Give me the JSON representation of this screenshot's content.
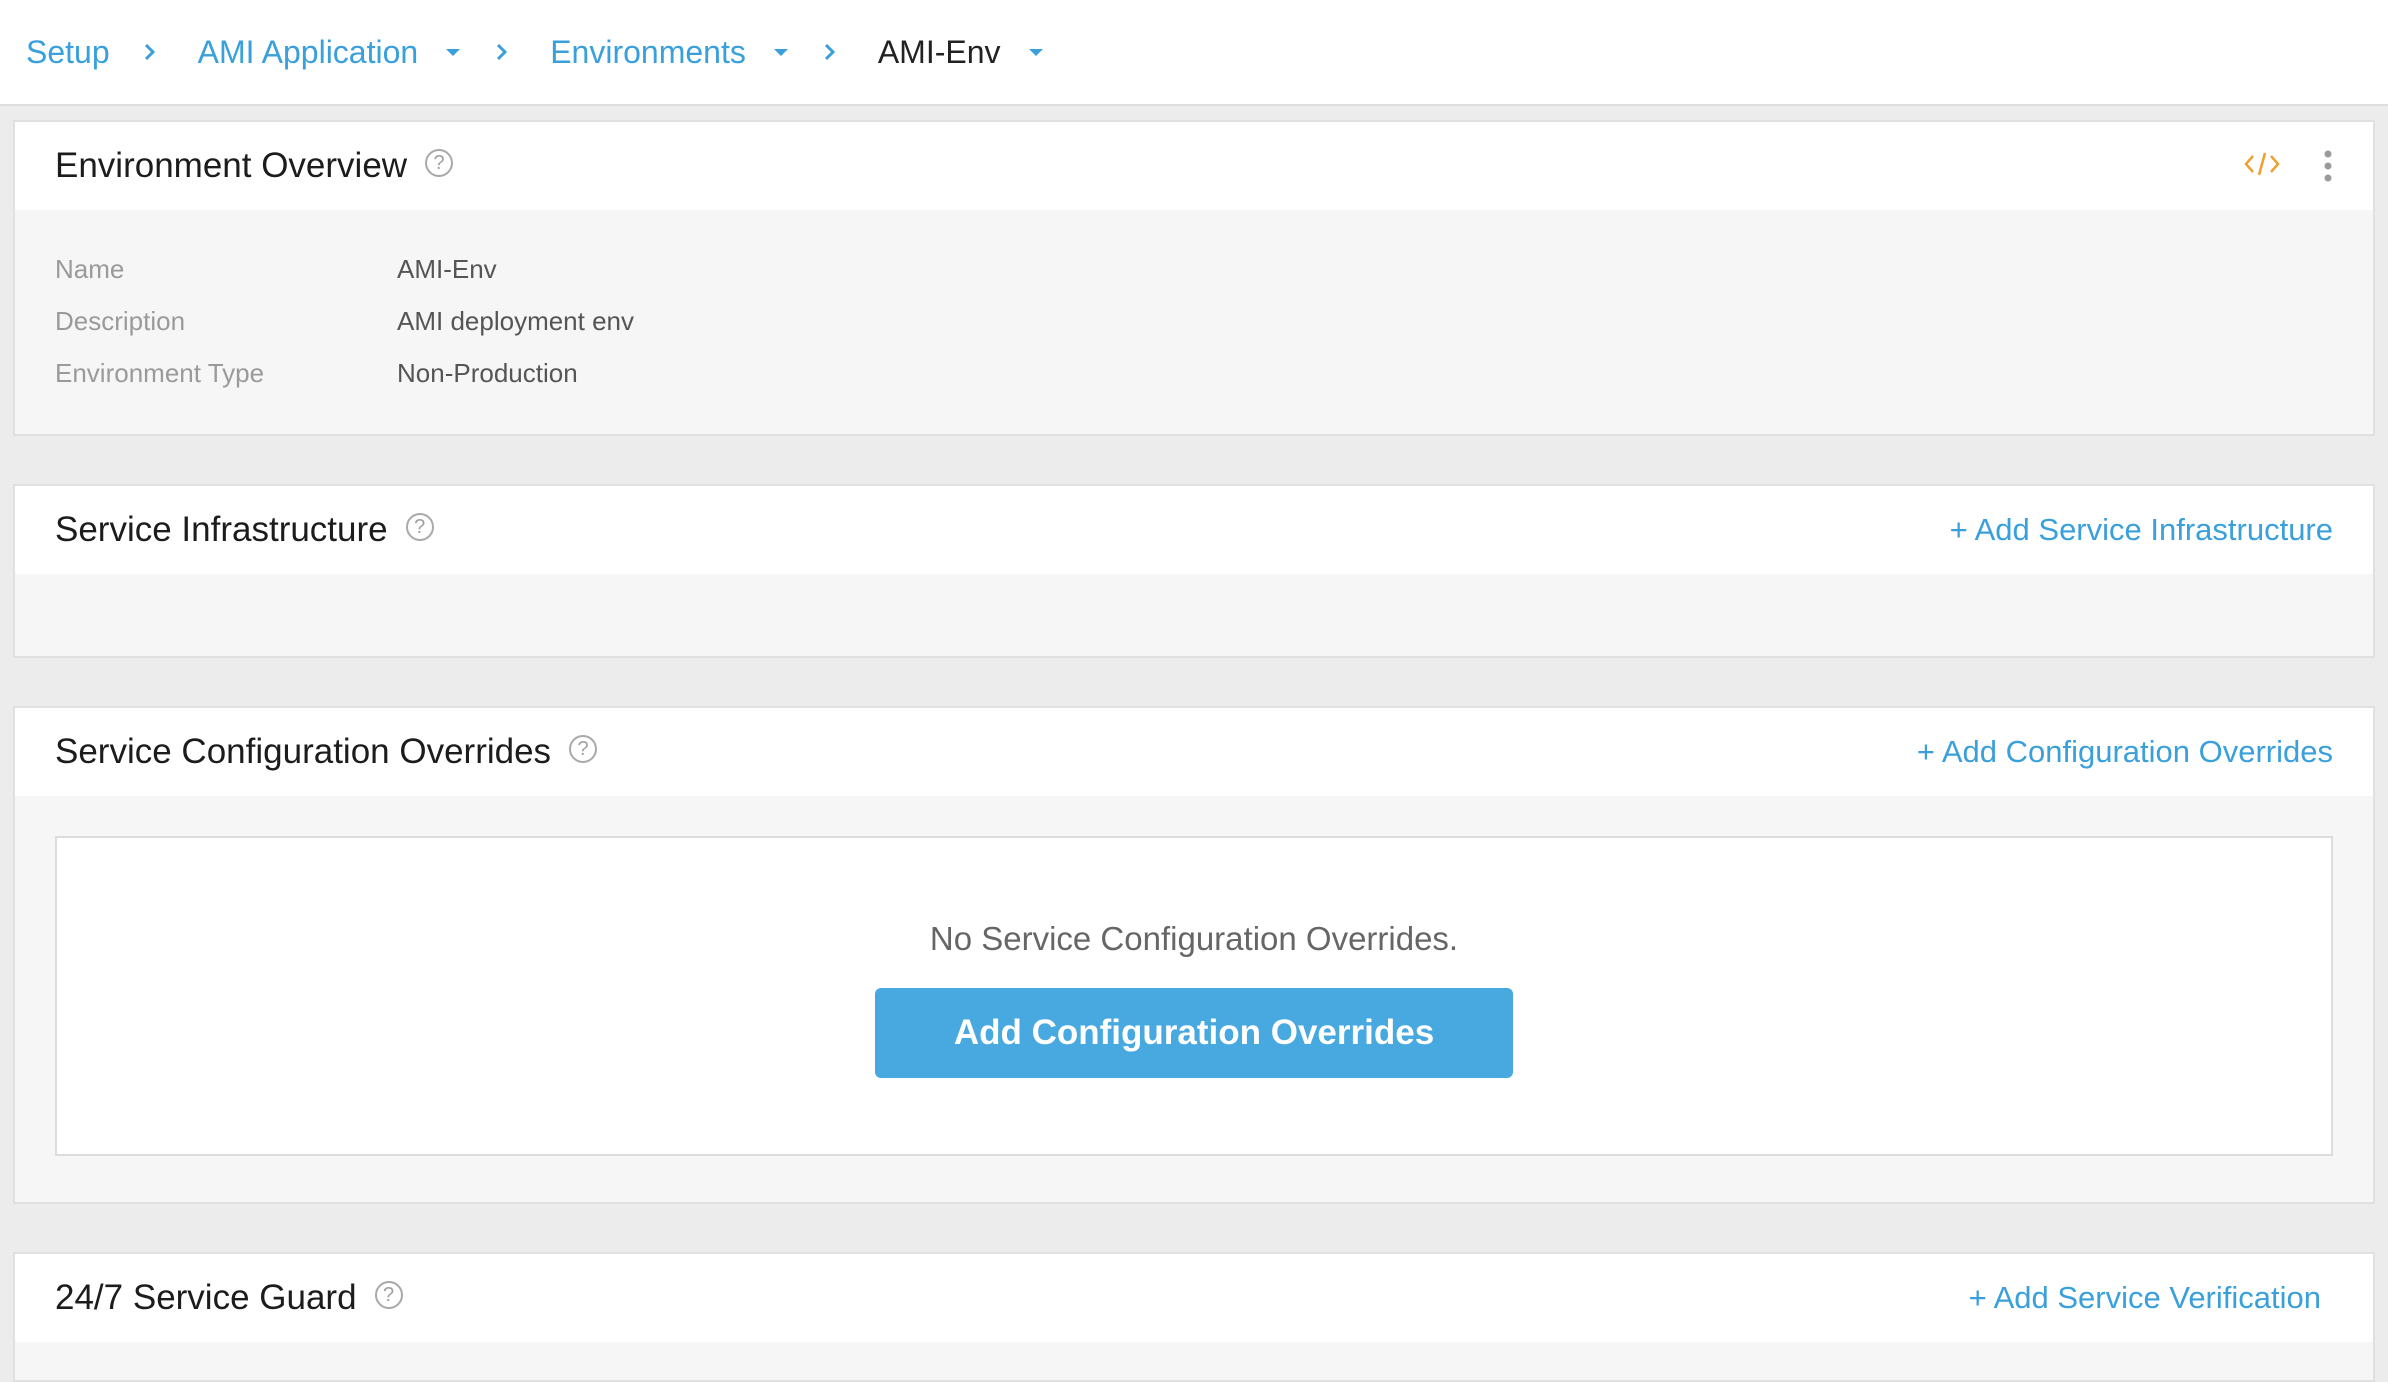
{
  "breadcrumb": {
    "setup": "Setup",
    "application": "AMI Application",
    "environments": "Environments",
    "current": "AMI-Env"
  },
  "overview": {
    "title": "Environment Overview",
    "help": "?",
    "fields": [
      {
        "label": "Name",
        "value": "AMI-Env"
      },
      {
        "label": "Description",
        "value": "AMI deployment env"
      },
      {
        "label": "Environment Type",
        "value": "Non-Production"
      }
    ]
  },
  "infrastructure": {
    "title": "Service Infrastructure",
    "help": "?",
    "action": "+ Add Service Infrastructure"
  },
  "overrides": {
    "title": "Service Configuration Overrides",
    "help": "?",
    "action": "+ Add Configuration Overrides",
    "empty_message": "No Service Configuration Overrides.",
    "button": "Add Configuration Overrides"
  },
  "service_guard": {
    "title": "24/7 Service Guard",
    "help": "?",
    "action": "+ Add Service Verification"
  },
  "colors": {
    "accent": "#3aa0db",
    "button": "#47a9e0",
    "code_icon": "#f0a030"
  }
}
